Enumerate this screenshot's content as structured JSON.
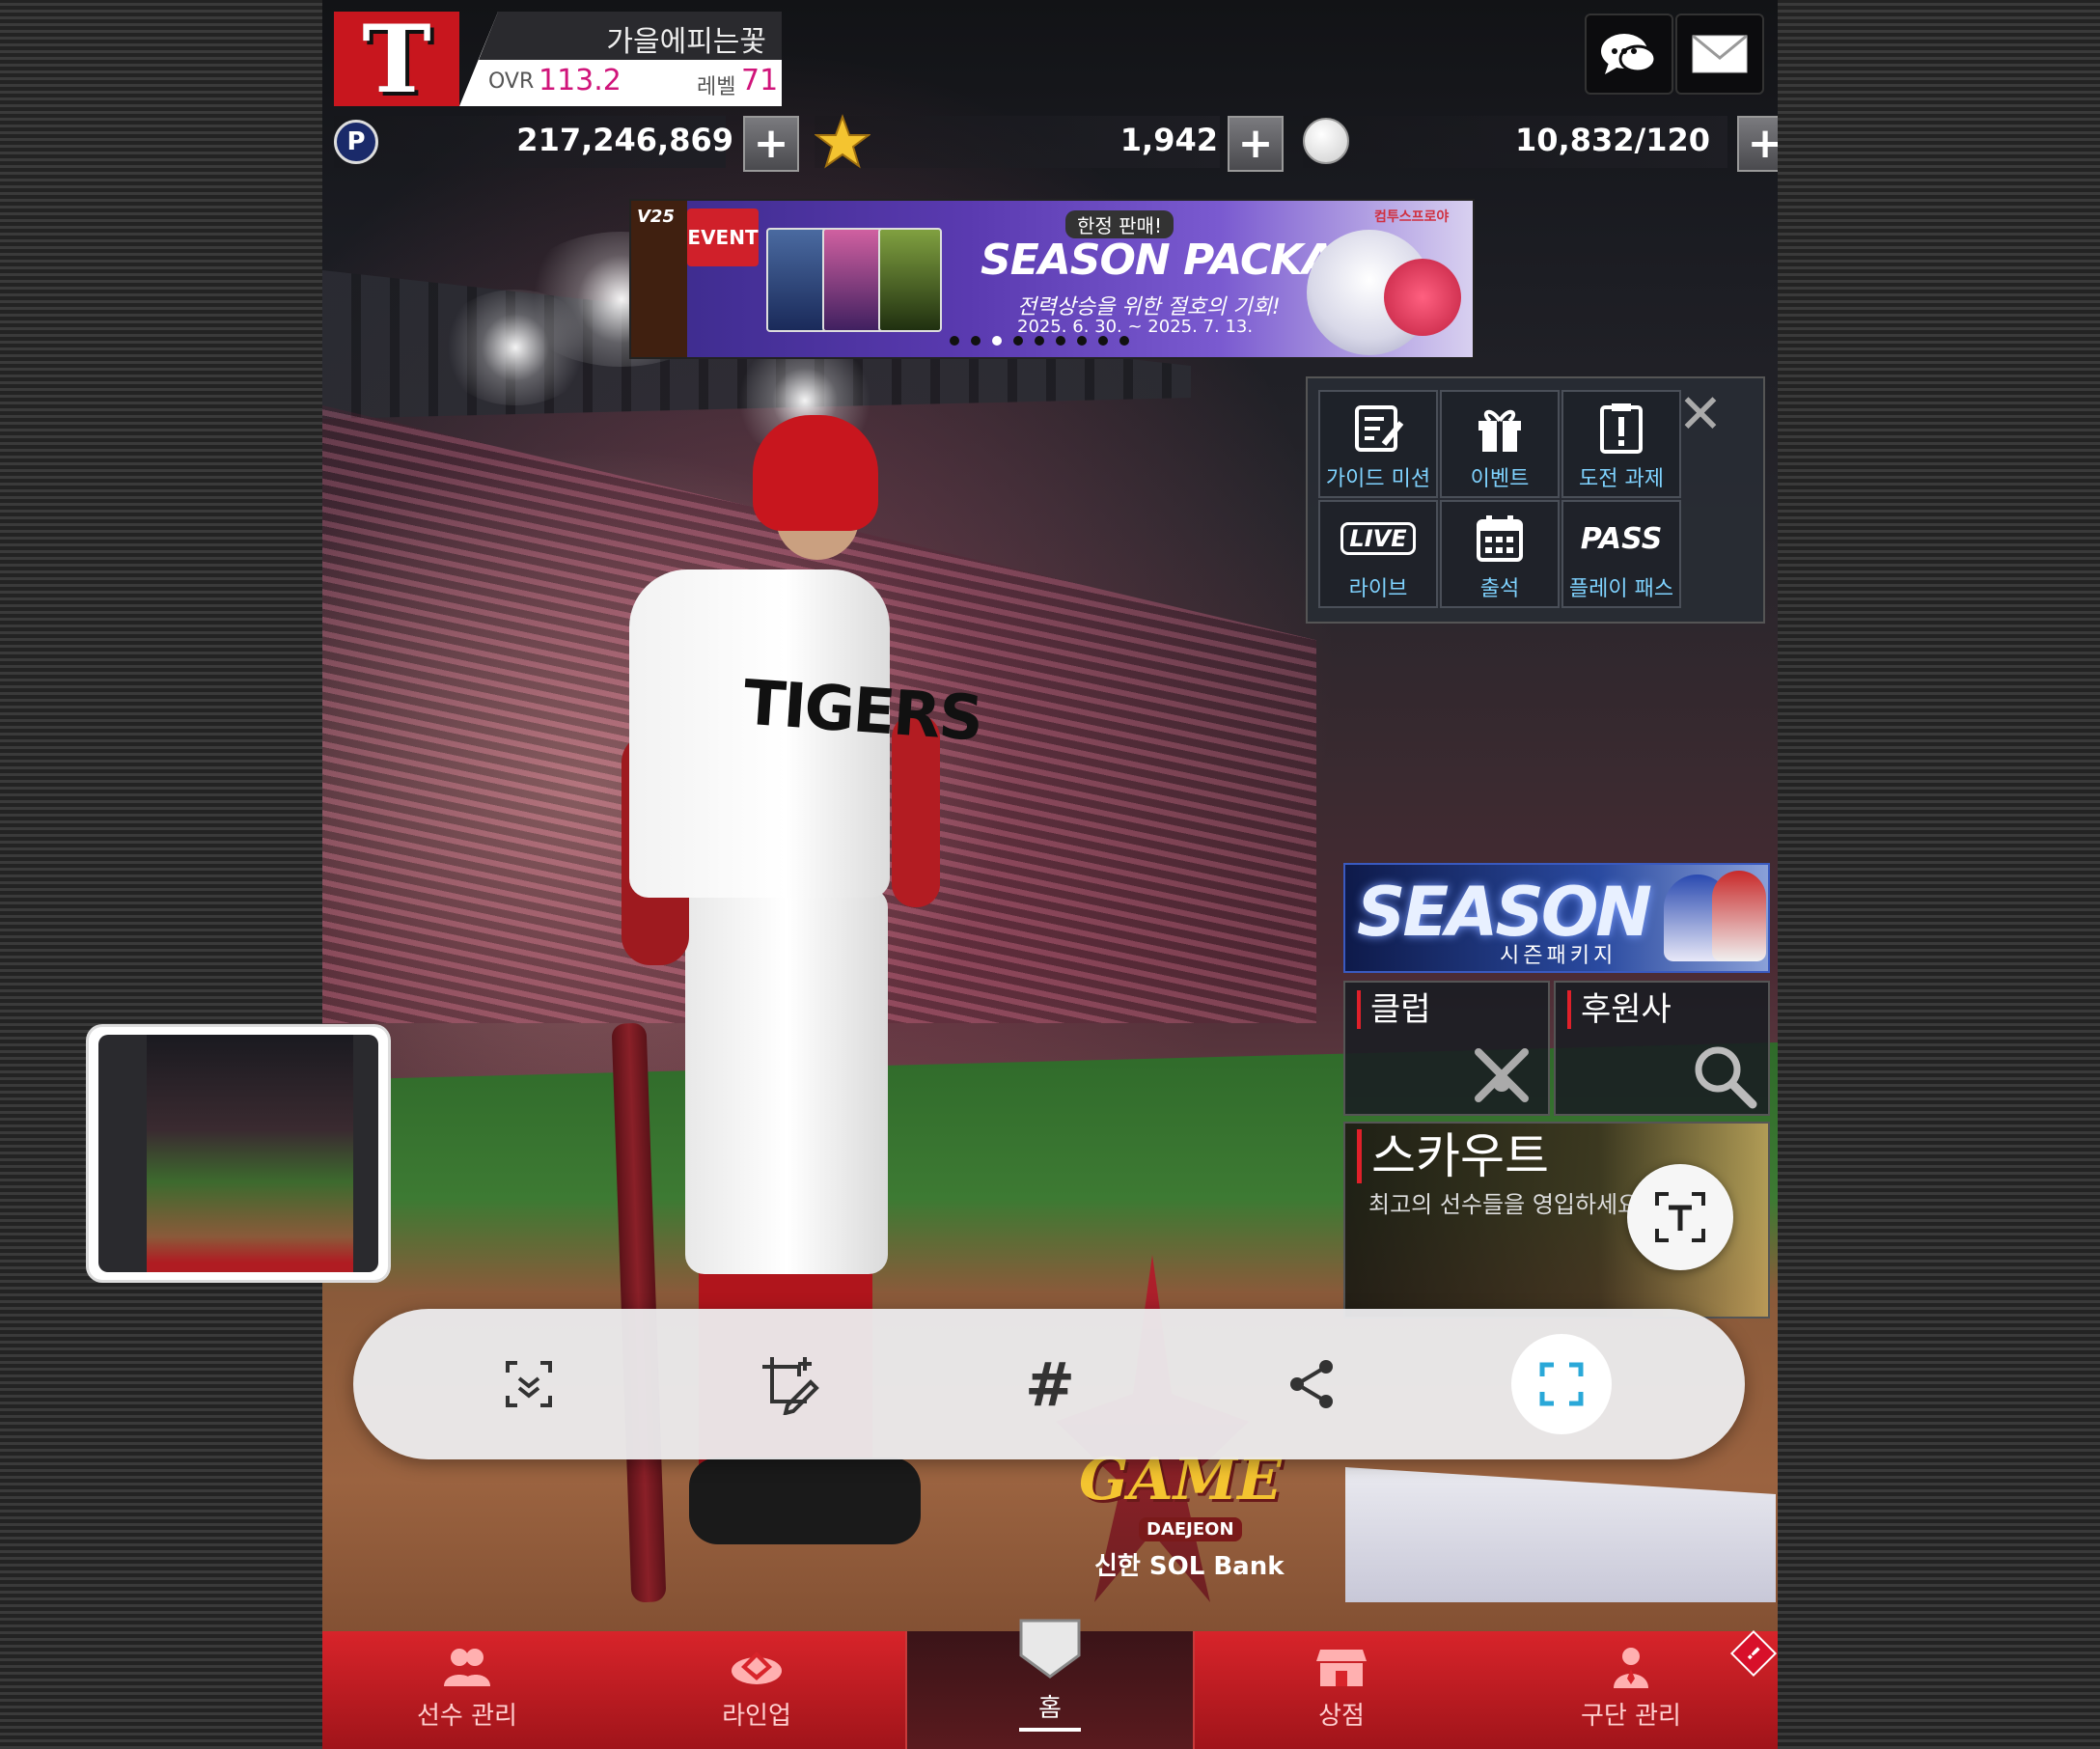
{
  "header": {
    "team_name": "가을에피는꽃",
    "ovr_label": "OVR",
    "ovr_value": "113.2",
    "level_label": "레벨",
    "level_value": "71",
    "logo_letter": "T"
  },
  "currencies": [
    {
      "icon": "p-coin-icon",
      "value": "217,246,869"
    },
    {
      "icon": "star-icon",
      "value": "1,942"
    },
    {
      "icon": "baseball-icon",
      "value": "10,832/120"
    }
  ],
  "plus_symbol": "+",
  "event_banner": {
    "badge": "EVENT",
    "corner_text": "V25",
    "promo": "한정 판매!",
    "title": "SEASON PACKAGE",
    "subtitle": "전력상승을 위한 절호의 기회!",
    "date": "2025. 6. 30. ~ 2025. 7. 13.",
    "brand": "컴투스프로야",
    "dots": 9,
    "active_dot": 2
  },
  "quick_menu": {
    "items": [
      {
        "label": "가이드 미션",
        "icon": "guide-mission-icon"
      },
      {
        "label": "이벤트",
        "icon": "gift-icon"
      },
      {
        "label": "도전 과제",
        "icon": "challenge-icon"
      },
      {
        "label": "라이브",
        "icon": "live-icon",
        "badge": "LIVE"
      },
      {
        "label": "출석",
        "icon": "calendar-icon"
      },
      {
        "label": "플레이 패스",
        "icon": "pass-icon",
        "badge": "PASS"
      }
    ],
    "close": "✕"
  },
  "player": {
    "jersey": "TIGERS"
  },
  "season_banner": {
    "title": "SEASON",
    "subtitle": "시즌패키지"
  },
  "side_panels": {
    "club": "클럽",
    "sponsor": "후원사",
    "scout_title": "스카우트",
    "scout_subtitle": "최고의 선수들을 영입하세요"
  },
  "allstar": {
    "game": "GAME",
    "city": "DAEJEON",
    "sponsor": "신한 SOL Bank"
  },
  "bottom_nav": [
    {
      "label": "선수 관리",
      "icon": "players-icon"
    },
    {
      "label": "라인업",
      "icon": "stadium-icon"
    },
    {
      "label": "홈",
      "icon": "home-plate-icon",
      "active": true
    },
    {
      "label": "상점",
      "icon": "shop-icon"
    },
    {
      "label": "구단 관리",
      "icon": "manager-icon",
      "alert": "!"
    }
  ],
  "screenshot_toolbar": {
    "buttons": [
      "scroll-capture-icon",
      "draw-crop-icon",
      "hashtag-icon",
      "share-icon",
      "crop-frame-icon"
    ],
    "hashtag": "#"
  },
  "colors": {
    "accent_red": "#c8161e",
    "ovr_pink": "#d0147a",
    "quick_menu_label": "#7fd3ff",
    "toolbar_active": "#2aa8d8"
  }
}
